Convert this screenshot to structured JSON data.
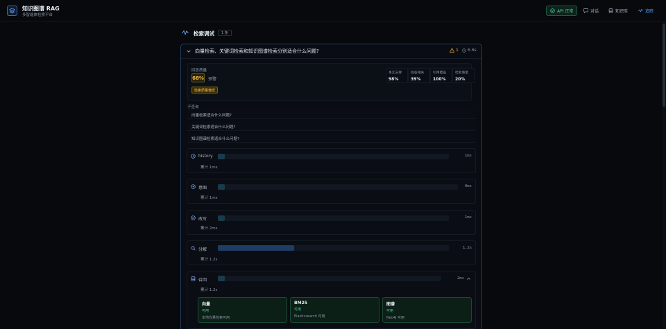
{
  "header": {
    "app_title": "知识图谱 RAG",
    "app_subtitle": "多智能体检索平台",
    "nav": {
      "api_label": "API 正常",
      "chat_label": "对话",
      "kb_label": "知识库",
      "trace_label": "追踪"
    }
  },
  "page": {
    "title": "检索调试",
    "count_badge": "1 条"
  },
  "query": {
    "text": "向量检索、关键词检索和知识图谱检索分别适合什么问题?",
    "warning_count": "1",
    "elapsed": "6.6s"
  },
  "quality": {
    "label": "回答质量",
    "score": "68%",
    "level": "预警",
    "badge": "检索质量偏低",
    "metrics": [
      {
        "label": "事实支撑",
        "value": "98%"
      },
      {
        "label": "回答相关",
        "value": "39%"
      },
      {
        "label": "引用覆盖",
        "value": "100%"
      },
      {
        "label": "检索质量",
        "value": "20%"
      }
    ]
  },
  "subqueries": {
    "label": "子查询",
    "items": [
      "向量检索适合什么问题?",
      "关键词检索适合什么问题?",
      "知识图谱检索适合什么问题?"
    ]
  },
  "steps": [
    {
      "name": "history",
      "duration": "1ms",
      "cumulative": "累计 1ms",
      "fill": 0.03,
      "icon": "clock-icon"
    },
    {
      "name": "意图",
      "duration": "0ms",
      "cumulative": "累计 1ms",
      "fill": 0.03,
      "icon": "target-icon"
    },
    {
      "name": "改写",
      "duration": "1ms",
      "cumulative": "累计 2ms",
      "fill": 0.03,
      "icon": "check-circle-icon"
    },
    {
      "name": "分解",
      "duration": "1.2s",
      "cumulative": "累计 1.2s",
      "fill": 0.33,
      "icon": "search-icon"
    },
    {
      "name": "召回",
      "duration": "2ms",
      "cumulative": "累计 1.2s",
      "fill": 0.03,
      "icon": "database-icon"
    }
  ],
  "sources": [
    {
      "name": "向量",
      "status": "可用",
      "desc": "本地向量检索可用"
    },
    {
      "name": "BM25",
      "status": "可用",
      "desc": "Elasticsearch 可用"
    },
    {
      "name": "图谱",
      "status": "可用",
      "desc": "Neo4j 可用"
    }
  ]
}
